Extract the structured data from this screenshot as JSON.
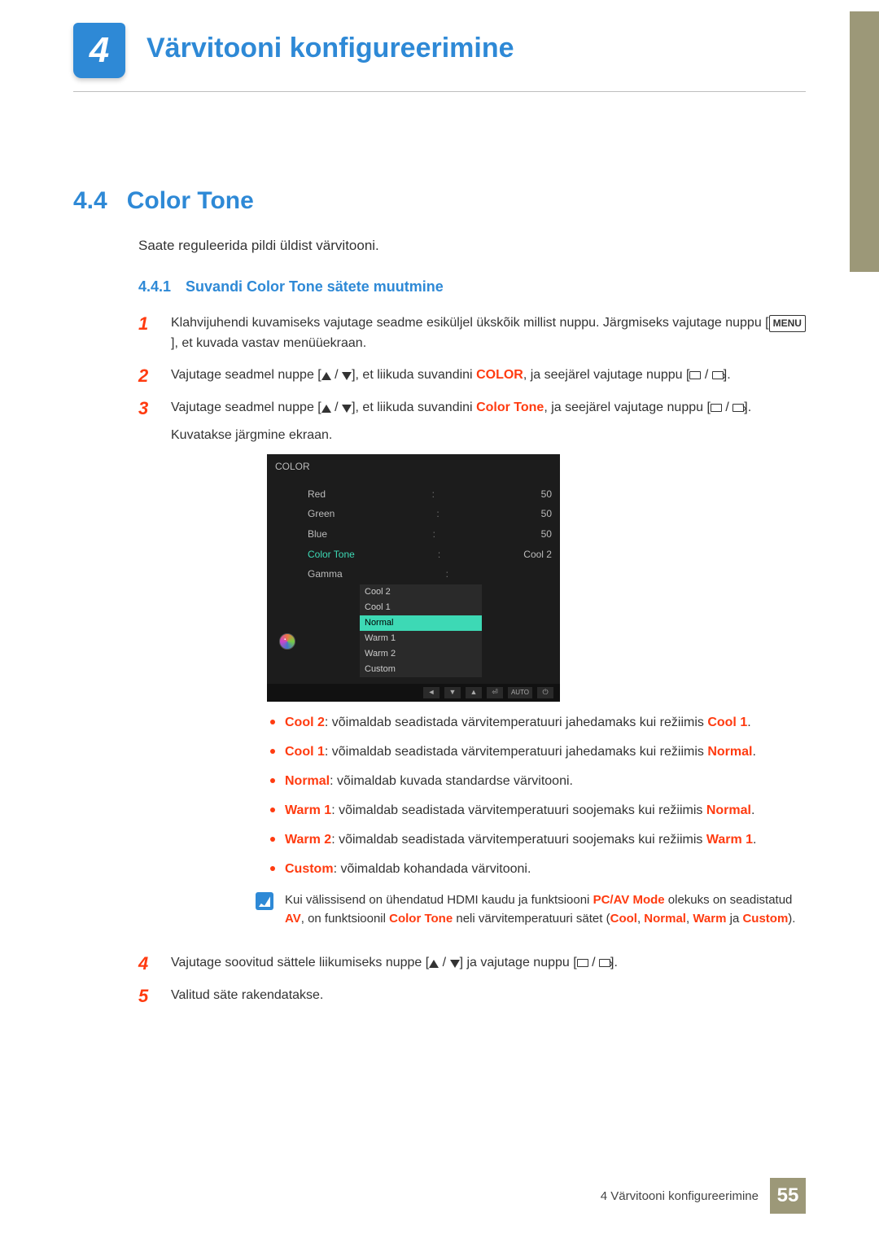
{
  "chapter": {
    "number": "4",
    "title": "Värvitooni konfigureerimine"
  },
  "section": {
    "number": "4.4",
    "title": "Color Tone"
  },
  "intro": "Saate reguleerida pildi üldist värvitooni.",
  "subsection": {
    "number": "4.4.1",
    "title": "Suvandi Color Tone sätete muutmine"
  },
  "steps": {
    "s1": {
      "a": "Klahvijuhendi kuvamiseks vajutage seadme esiküljel ükskõik millist nuppu. Järgmiseks vajutage nuppu [",
      "menu": "MENU",
      "b": "], et kuvada vastav menüüekraan."
    },
    "s2": {
      "a": "Vajutage seadmel nuppe [",
      "b": "], et liikuda suvandini ",
      "kw": "COLOR",
      "c": ", ja seejärel vajutage nuppu [",
      "d": "]."
    },
    "s3": {
      "a": "Vajutage seadmel nuppe [",
      "b": "], et liikuda suvandini ",
      "kw": "Color Tone",
      "c": ", ja seejärel vajutage nuppu [",
      "d": "].",
      "e": "Kuvatakse järgmine ekraan."
    },
    "s4": {
      "a": "Vajutage soovitud sättele liikumiseks nuppe [",
      "b": "] ja vajutage nuppu [",
      "c": "]."
    },
    "s5": "Valitud säte rakendatakse."
  },
  "osd": {
    "title": "COLOR",
    "rows": [
      {
        "label": "Red",
        "value": "50"
      },
      {
        "label": "Green",
        "value": "50"
      },
      {
        "label": "Blue",
        "value": "50"
      },
      {
        "label": "Color Tone",
        "value": "Cool 2"
      },
      {
        "label": "Gamma",
        "value": ""
      }
    ],
    "dropdown": [
      "Cool 2",
      "Cool 1",
      "Normal",
      "Warm 1",
      "Warm 2",
      "Custom"
    ],
    "auto": "AUTO"
  },
  "bullets": [
    {
      "kw": "Cool 2",
      "mid": ": võimaldab seadistada värvitemperatuuri jahedamaks kui režiimis ",
      "kw2": "Cool 1",
      "end": "."
    },
    {
      "kw": "Cool 1",
      "mid": ": võimaldab seadistada värvitemperatuuri jahedamaks kui režiimis ",
      "kw2": "Normal",
      "end": "."
    },
    {
      "kw": "Normal",
      "mid": ": võimaldab kuvada standardse värvitooni.",
      "kw2": "",
      "end": ""
    },
    {
      "kw": "Warm 1",
      "mid": ": võimaldab seadistada värvitemperatuuri soojemaks kui režiimis ",
      "kw2": "Normal",
      "end": "."
    },
    {
      "kw": "Warm 2",
      "mid": ": võimaldab seadistada värvitemperatuuri soojemaks kui režiimis ",
      "kw2": "Warm 1",
      "end": "."
    },
    {
      "kw": "Custom",
      "mid": ": võimaldab kohandada värvitooni.",
      "kw2": "",
      "end": ""
    }
  ],
  "note": {
    "a": "Kui välissisend on ühendatud HDMI kaudu ja funktsiooni ",
    "kw1": "PC/AV Mode",
    "b": " olekuks on seadistatud ",
    "kw2": "AV",
    "c": ", on funktsioonil ",
    "kw3": "Color Tone",
    "d": " neli värvitemperatuuri sätet (",
    "kw4": "Cool",
    "e": ", ",
    "kw5": "Normal",
    "f": ", ",
    "kw6": "Warm",
    "g": " ja ",
    "kw7": "Custom",
    "h": ")."
  },
  "footer": {
    "text": "4 Värvitooni konfigureerimine",
    "page": "55"
  }
}
